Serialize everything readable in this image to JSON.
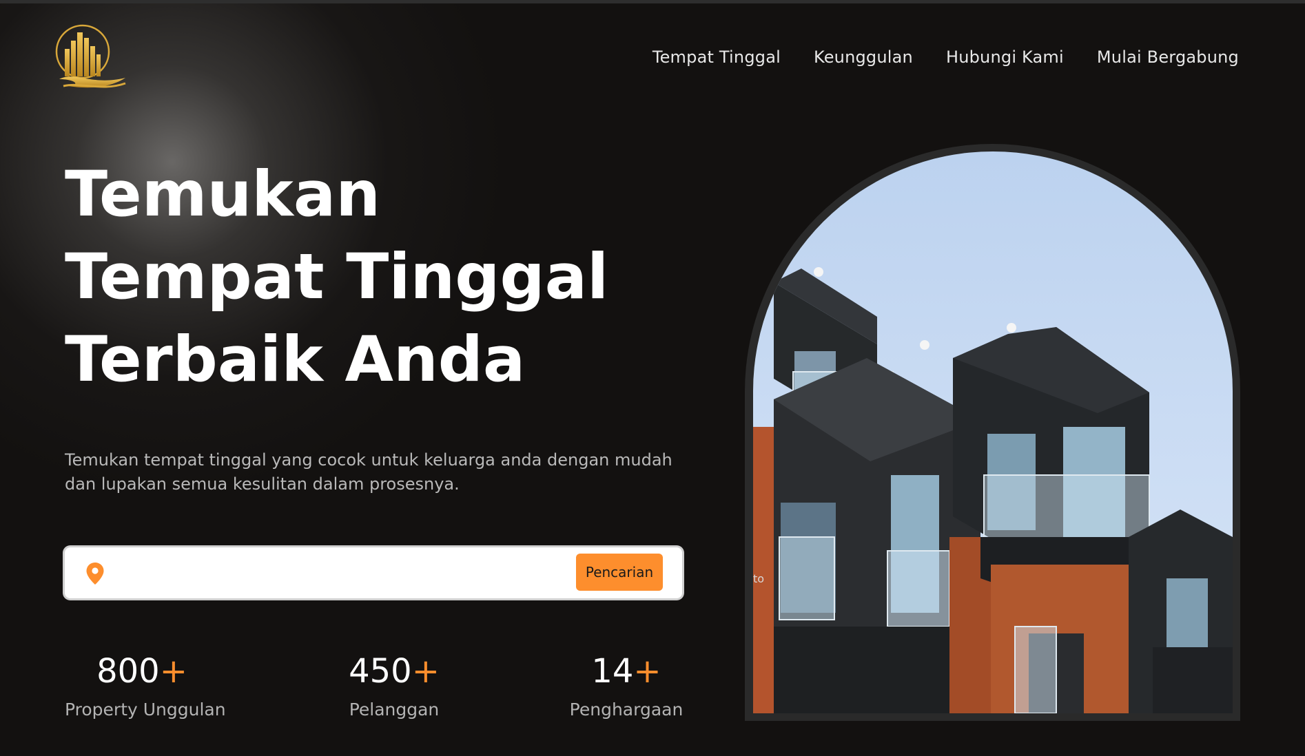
{
  "nav": {
    "items": [
      {
        "label": "Tempat Tinggal"
      },
      {
        "label": "Keunggulan"
      },
      {
        "label": "Hubungi Kami"
      },
      {
        "label": "Mulai Bergabung"
      }
    ]
  },
  "hero": {
    "title_lines": [
      "Temukan",
      "Tempat Tinggal",
      "Terbaik Anda"
    ],
    "subtitle": "Temukan tempat tinggal yang cocok untuk keluarga anda dengan mudah dan lupakan semua kesulitan dalam prosesnya."
  },
  "search": {
    "icon": "location-pin-icon",
    "value": "",
    "placeholder": "",
    "button_label": "Pencarian"
  },
  "stats": [
    {
      "number": "800",
      "suffix": "+",
      "label": "Property Unggulan"
    },
    {
      "number": "450",
      "suffix": "+",
      "label": "Pelanggan"
    },
    {
      "number": "14",
      "suffix": "+",
      "label": "Penghargaan"
    }
  ],
  "image": {
    "watermark": "to"
  },
  "colors": {
    "background": "#131110",
    "accent": "#fd8e2d",
    "logo_gold": "#d9a83a",
    "text": "#ffffff",
    "muted_text": "#b9b9b9"
  }
}
